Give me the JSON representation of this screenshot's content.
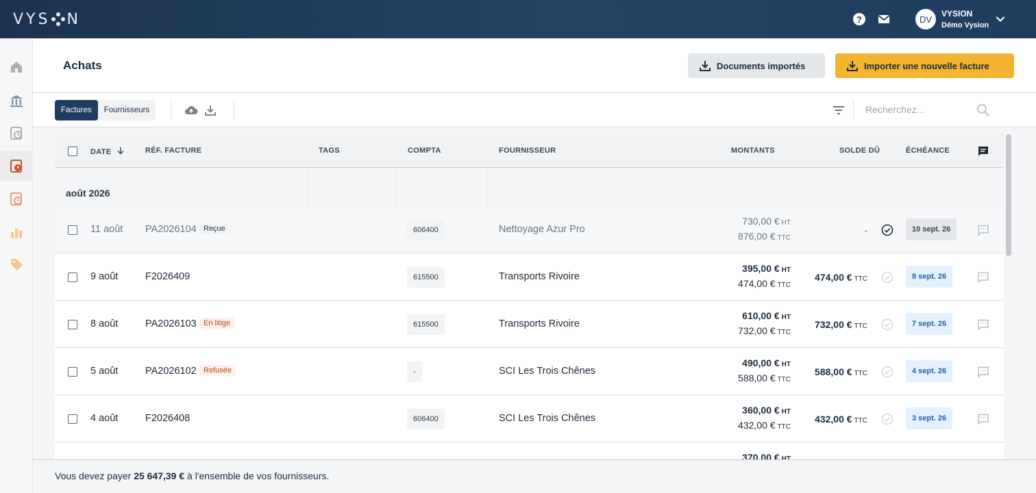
{
  "app": {
    "logo_left": "VYS",
    "logo_right": "N"
  },
  "topbar": {
    "help_icon": "help-icon",
    "mail_icon": "mail-icon",
    "user": {
      "initials": "DV",
      "name": "VYSION",
      "org": "Démo Vysion"
    }
  },
  "sidebar": {
    "items": [
      "home-icon",
      "bank-icon",
      "sales-icon",
      "purchases-icon",
      "expenses-icon",
      "reports-icon",
      "tag-icon"
    ],
    "active_index": 3
  },
  "header": {
    "title": "Achats",
    "docs_button": "Documents importés",
    "import_button": "Importer une nouvelle facture"
  },
  "toolbar": {
    "tab_invoices": "Factures",
    "tab_suppliers": "Fournisseurs",
    "search_placeholder": "Recherchez..."
  },
  "table": {
    "columns": {
      "date": "DATE",
      "ref": "RÉF. FACTURE",
      "tags": "TAGS",
      "compta": "COMPTA",
      "supplier": "FOURNISSEUR",
      "amounts": "MONTANTS",
      "balance": "SOLDE DÛ",
      "due": "ÉCHÉANCE"
    },
    "group": "août 2026",
    "unit_ht": "HT",
    "unit_ttc": "TTC",
    "rows": [
      {
        "date": "11 août",
        "ref": "PA2026104",
        "status": "Reçue",
        "compta": "606400",
        "supplier": "Nettoyage Azur Pro",
        "ht": "730,00 €",
        "ttc": "876,00 €",
        "balance": "-",
        "due": "10 sept. 26"
      },
      {
        "date": "9 août",
        "ref": "F2026409",
        "status": "",
        "compta": "615500",
        "supplier": "Transports Rivoire",
        "ht": "395,00 €",
        "ttc": "474,00 €",
        "balance": "474,00 €",
        "due": "8 sept. 26"
      },
      {
        "date": "8 août",
        "ref": "PA2026103",
        "status": "En litige",
        "compta": "615500",
        "supplier": "Transports Rivoire",
        "ht": "610,00 €",
        "ttc": "732,00 €",
        "balance": "732,00 €",
        "due": "7 sept. 26"
      },
      {
        "date": "5 août",
        "ref": "PA2026102",
        "status": "Refusée",
        "compta": "-",
        "supplier": "SCI Les Trois Chênes",
        "ht": "490,00 €",
        "ttc": "588,00 €",
        "balance": "588,00 €",
        "due": "4 sept. 26"
      },
      {
        "date": "4 août",
        "ref": "F2026408",
        "status": "",
        "compta": "606400",
        "supplier": "SCI Les Trois Chênes",
        "ht": "360,00 €",
        "ttc": "432,00 €",
        "balance": "432,00 €",
        "due": "3 sept. 26"
      },
      {
        "date": "",
        "ref": "",
        "status": "",
        "compta": "",
        "supplier": "",
        "ht": "370,00 €",
        "ttc": "",
        "balance": "",
        "due": ""
      }
    ]
  },
  "footer": {
    "prefix": "Vous devez payer",
    "amount": "25 647,39 €",
    "suffix": "à l'ensemble de vos fournisseurs."
  },
  "colors": {
    "topbar": "#1f3d5e",
    "accent": "#f2b431",
    "danger": "#c24a1c",
    "due_blue": "#1f63a8"
  }
}
